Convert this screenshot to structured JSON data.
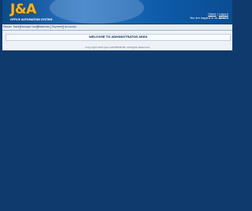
{
  "header": {
    "logo_main": "J&A",
    "logo_sub": "OFFICE AUTOMATION SYSTEM",
    "user_line1_prefix": "",
    "user_line1_home": "Home",
    "user_line1_sep": "|",
    "user_line1_logout": "Logout",
    "user_line2": "You are logged in as",
    "user_name": "Admin"
  },
  "nav": {
    "items": [
      "Master Tables",
      "Manage Users",
      "Materials",
      "Payment",
      "Accounts"
    ]
  },
  "main": {
    "welcome": "WELCOME TO ADMINISTRATOR AREA"
  },
  "footer": {
    "copyright": "Copyright 2011 J&A AUTOMATION. All Rights Reserved"
  },
  "colors": {
    "page_bg": "#0e3a6e",
    "header_bg": "#1f6bb8",
    "logo_accent": "#f4b324"
  }
}
